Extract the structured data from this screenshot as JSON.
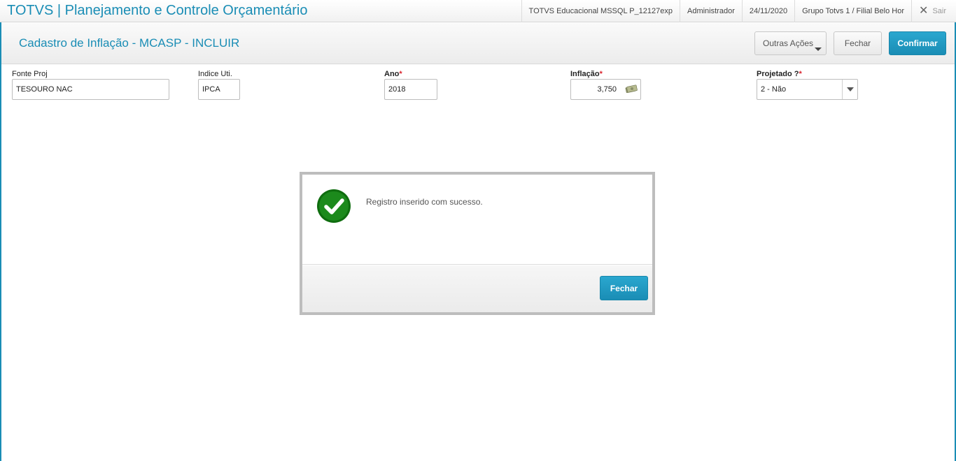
{
  "topbar": {
    "app_title": "TOTVS | Planejamento e Controle Orçamentário",
    "environment": "TOTVS Educacional MSSQL P_12127exp",
    "user": "Administrador",
    "date": "24/11/2020",
    "company": "Grupo Totvs 1 / Filial Belo Hor",
    "exit_label": "Sair"
  },
  "header": {
    "page_title": "Cadastro de Inflação - MCASP - INCLUIR",
    "other_actions_label": "Outras Ações",
    "close_label": "Fechar",
    "confirm_label": "Confirmar"
  },
  "form": {
    "fonte_proj": {
      "label": "Fonte Proj",
      "value": "TESOURO NAC"
    },
    "indice_uti": {
      "label": "Indice Uti.",
      "value": "IPCA"
    },
    "ano": {
      "label": "Ano",
      "required_mark": "*",
      "value": "2018"
    },
    "inflacao": {
      "label": "Inflação",
      "required_mark": "*",
      "value": "3,750"
    },
    "projetado": {
      "label": "Projetado ?",
      "required_mark": "*",
      "value": "2 - Não"
    }
  },
  "modal": {
    "message": "Registro inserido com sucesso.",
    "close_label": "Fechar"
  },
  "colors": {
    "brand": "#1a8db5",
    "success": "#1c8a1c",
    "required": "#d9232d"
  },
  "icons": {
    "success": "check-circle-icon",
    "currency": "money-icon",
    "exit": "close-icon"
  }
}
